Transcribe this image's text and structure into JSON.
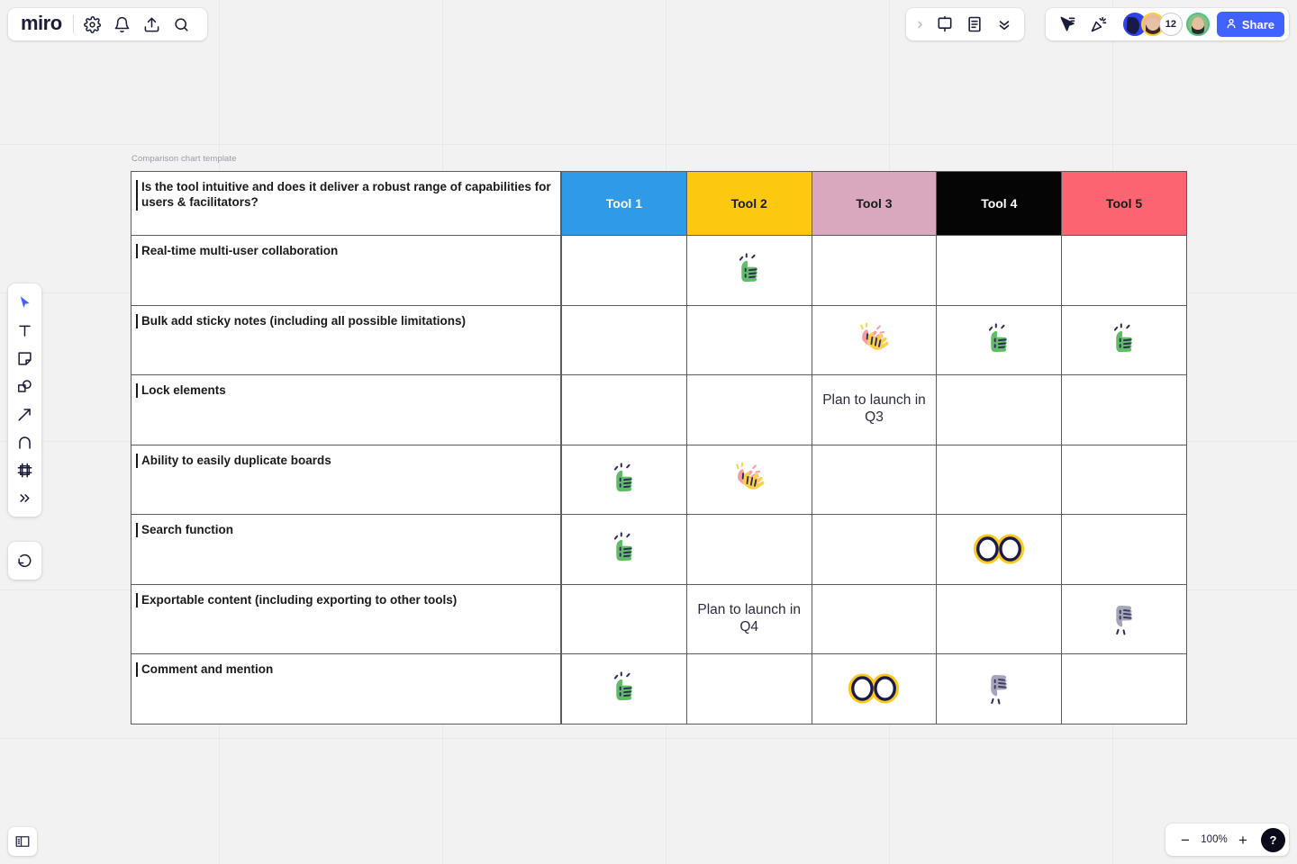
{
  "app": {
    "name": "miro",
    "brand_color": "#1b1b3a",
    "share_button": "Share",
    "accent": "#4262ff"
  },
  "toolbar_top_left": {
    "icons": [
      {
        "name": "gear-icon",
        "label": "Settings"
      },
      {
        "name": "bell-icon",
        "label": "Notifications"
      },
      {
        "name": "upload-icon",
        "label": "Upload"
      },
      {
        "name": "search-icon",
        "label": "Search"
      }
    ]
  },
  "toolbar_top_right": {
    "present_group": [
      {
        "name": "chevron-right-icon",
        "label": "Expand"
      },
      {
        "name": "present-icon",
        "label": "Present"
      },
      {
        "name": "notes-icon",
        "label": "Notes"
      },
      {
        "name": "chevrons-down-icon",
        "label": "More"
      }
    ],
    "collab_group": [
      {
        "name": "cursor-chat-icon",
        "label": "Cursor chat"
      },
      {
        "name": "celebrate-icon",
        "label": "Reactions"
      }
    ],
    "avatars": [
      {
        "name": "avatar-miro",
        "type": "logo"
      },
      {
        "name": "avatar-user-1",
        "type": "photo"
      },
      {
        "name": "avatar-overflow-count",
        "type": "count",
        "count": "12"
      },
      {
        "name": "avatar-user-2",
        "type": "photo"
      }
    ]
  },
  "tool_rail": {
    "tools": [
      {
        "name": "select-tool",
        "label": "Select",
        "active": true
      },
      {
        "name": "text-tool",
        "label": "Text",
        "active": false
      },
      {
        "name": "sticky-note-tool",
        "label": "Sticky note",
        "active": false
      },
      {
        "name": "shapes-tool",
        "label": "Shapes",
        "active": false
      },
      {
        "name": "connection-line-tool",
        "label": "Connection line",
        "active": false
      },
      {
        "name": "pen-tool",
        "label": "Pen",
        "active": false
      },
      {
        "name": "frame-tool",
        "label": "Frame",
        "active": false
      },
      {
        "name": "more-tools",
        "label": "More tools",
        "active": false
      }
    ],
    "undo": {
      "name": "undo-button",
      "label": "Undo"
    }
  },
  "bottom_bar": {
    "panel_toggle": "Toggle panel",
    "zoom_out": "−",
    "zoom_level": "100%",
    "zoom_in": "+",
    "help": "?"
  },
  "board": {
    "object_label": "Comparison chart template"
  },
  "chart_data": {
    "type": "table",
    "title": "Comparison chart template",
    "question": "Is the tool intuitive and does it deliver a robust range of capabilities for users & facilitators?",
    "columns": [
      {
        "label": "Tool 1",
        "bg": "#2e9ae8",
        "fg": "#ffffff"
      },
      {
        "label": "Tool 2",
        "bg": "#fbc910",
        "fg": "#1a1a1a"
      },
      {
        "label": "Tool 3",
        "bg": "#d9a8bf",
        "fg": "#1a1a1a"
      },
      {
        "label": "Tool 4",
        "bg": "#050505",
        "fg": "#ffffff"
      },
      {
        "label": "Tool 5",
        "bg": "#fb6470",
        "fg": "#1a1a1a"
      }
    ],
    "rows": [
      {
        "criterion": "Real-time multi-user collaboration",
        "cells": [
          {
            "kind": "empty"
          },
          {
            "kind": "emoji",
            "emoji": "thumbs-up"
          },
          {
            "kind": "empty"
          },
          {
            "kind": "empty"
          },
          {
            "kind": "empty"
          }
        ]
      },
      {
        "criterion": "Bulk add sticky notes (including all possible limitations)",
        "cells": [
          {
            "kind": "empty"
          },
          {
            "kind": "empty"
          },
          {
            "kind": "emoji",
            "emoji": "clapping-hands"
          },
          {
            "kind": "emoji",
            "emoji": "thumbs-up"
          },
          {
            "kind": "emoji",
            "emoji": "thumbs-up"
          }
        ]
      },
      {
        "criterion": "Lock elements",
        "cells": [
          {
            "kind": "empty"
          },
          {
            "kind": "empty"
          },
          {
            "kind": "note",
            "text": "Plan to launch in Q3"
          },
          {
            "kind": "empty"
          },
          {
            "kind": "empty"
          }
        ]
      },
      {
        "criterion": "Ability to easily duplicate boards",
        "cells": [
          {
            "kind": "emoji",
            "emoji": "thumbs-up"
          },
          {
            "kind": "emoji",
            "emoji": "clapping-hands"
          },
          {
            "kind": "empty"
          },
          {
            "kind": "empty"
          },
          {
            "kind": "empty"
          }
        ]
      },
      {
        "criterion": "Search function",
        "cells": [
          {
            "kind": "emoji",
            "emoji": "thumbs-up"
          },
          {
            "kind": "empty"
          },
          {
            "kind": "empty"
          },
          {
            "kind": "emoji",
            "emoji": "eyes"
          },
          {
            "kind": "empty"
          }
        ]
      },
      {
        "criterion": "Exportable content (including exporting to other tools)",
        "cells": [
          {
            "kind": "empty"
          },
          {
            "kind": "note",
            "text": "Plan to launch in Q4"
          },
          {
            "kind": "empty"
          },
          {
            "kind": "empty"
          },
          {
            "kind": "emoji",
            "emoji": "thumbs-down"
          }
        ]
      },
      {
        "criterion": "Comment and mention",
        "cells": [
          {
            "kind": "emoji",
            "emoji": "thumbs-up"
          },
          {
            "kind": "empty"
          },
          {
            "kind": "emoji",
            "emoji": "eyes"
          },
          {
            "kind": "emoji",
            "emoji": "thumbs-down"
          },
          {
            "kind": "empty"
          }
        ]
      }
    ]
  }
}
